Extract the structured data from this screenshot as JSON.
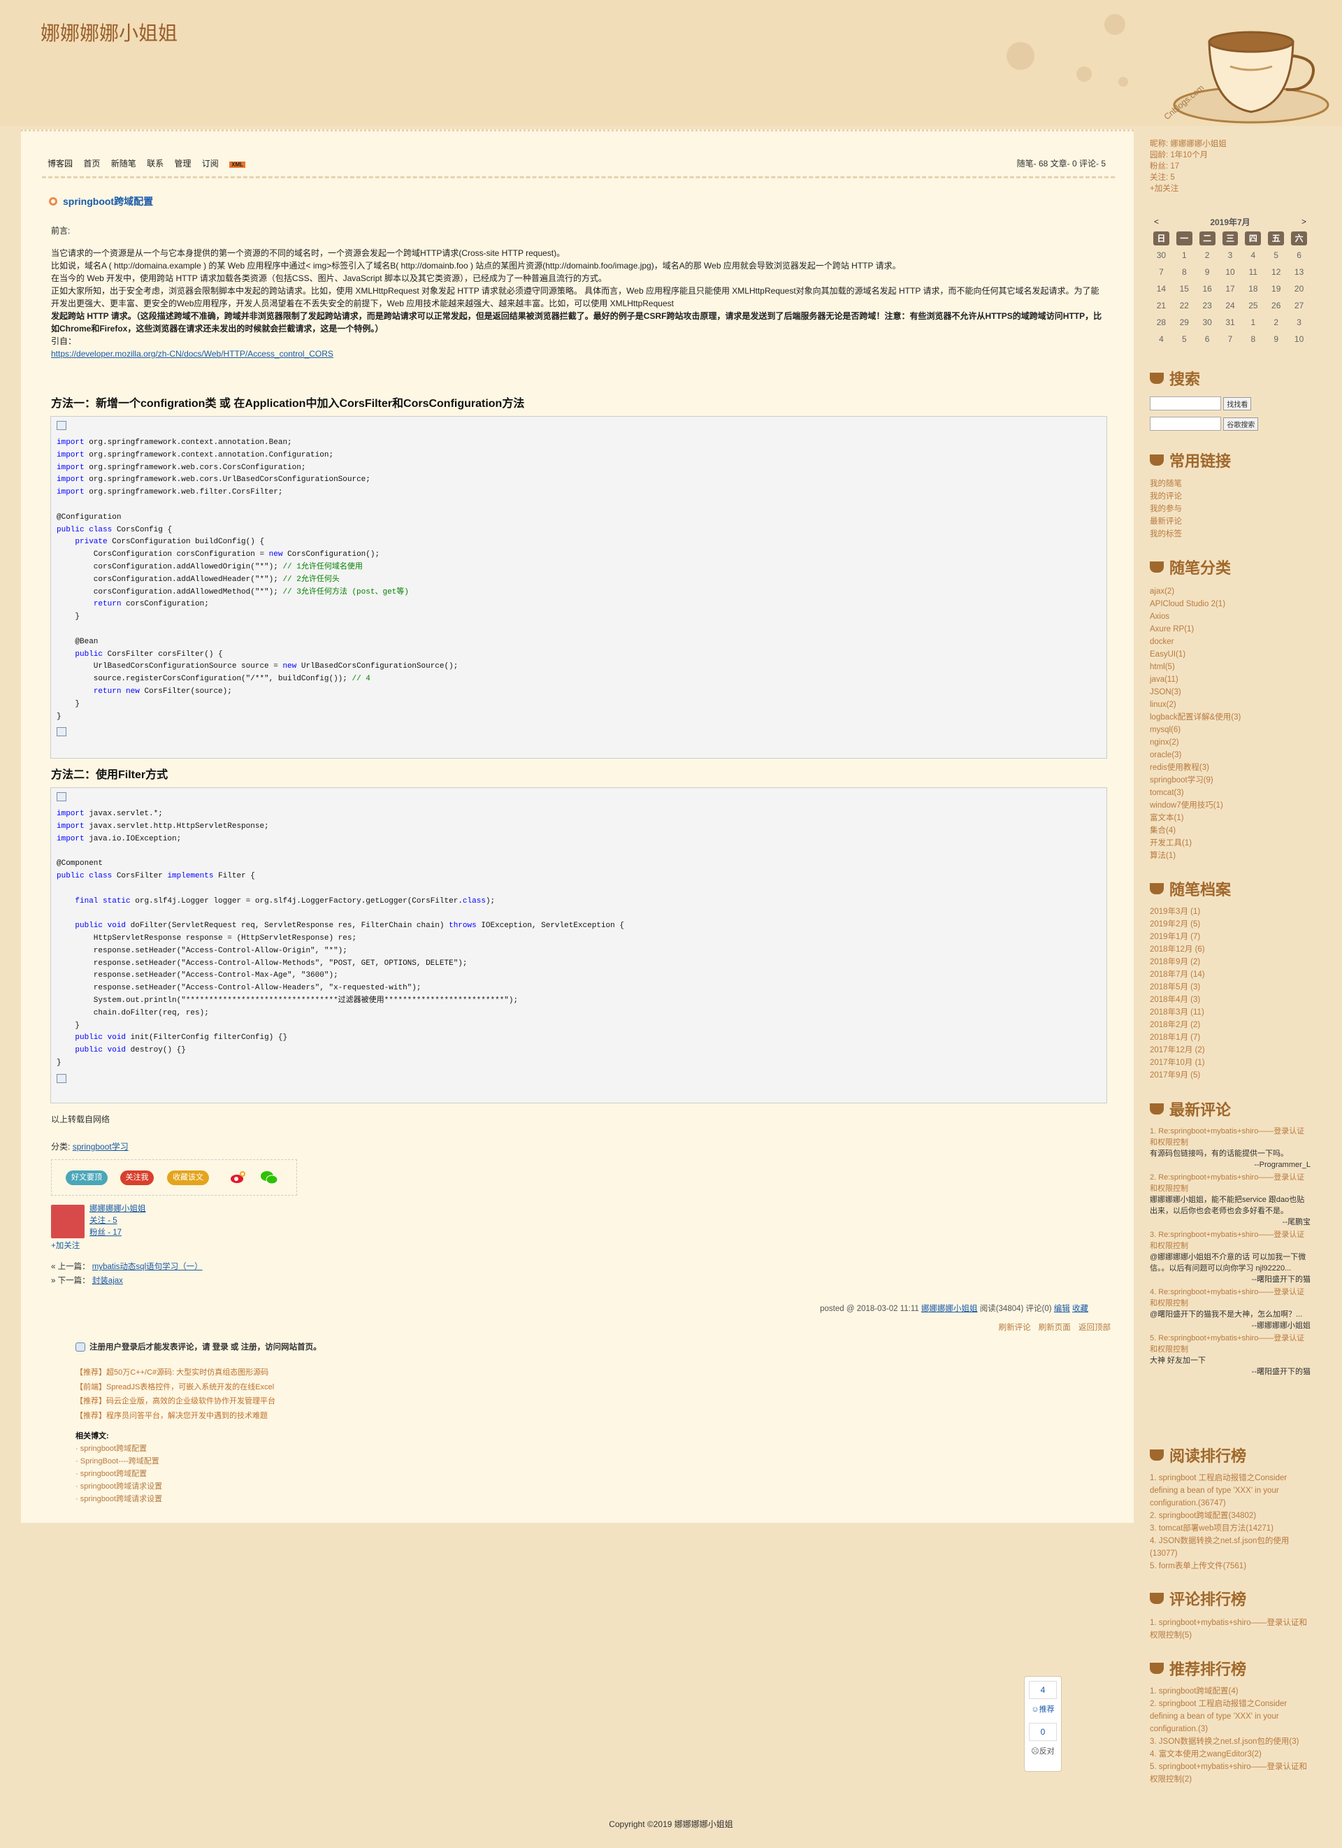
{
  "blog": {
    "title": "娜娜娜娜小姐姐",
    "cup_text": "Cnblogs.com"
  },
  "nav": [
    "博客园",
    "首页",
    "新随笔",
    "联系",
    "管理",
    "订阅"
  ],
  "nav_xml": "XML",
  "stats": "随笔- 68  文章- 0  评论- 5",
  "post": {
    "title": "springboot跨域配置",
    "intro_label": "前言:",
    "paragraphs": [
      "当它请求的一个资源是从一个与它本身提供的第一个资源的不同的域名时，一个资源会发起一个跨域HTTP请求(Cross-site HTTP request)。",
      "比如说，域名A ( http://domaina.example ) 的某 Web 应用程序中通过< img>标签引入了域名B( http://domainb.foo ) 站点的某图片资源(http://domainb.foo/image.jpg)，域名A的那 Web 应用就会导致浏览器发起一个跨站 HTTP 请求。",
      "在当今的 Web 开发中，使用跨站 HTTP 请求加载各类资源（包括CSS、图片、JavaScript 脚本以及其它类资源），已经成为了一种普遍且流行的方式。",
      "正如大家所知，出于安全考虑，浏览器会限制脚本中发起的跨站请求。比如，使用 XMLHttpRequest 对象发起 HTTP 请求就必须遵守同源策略。 具体而言，Web 应用程序能且只能使用 XMLHttpRequest对象向其加载的源域名发起 HTTP 请求，而不能向任何其它域名发起请求。为了能开发出更强大、更丰富、更安全的Web应用程序，开发人员渴望着在不丢失安全的前提下，Web 应用技术能越来越强大、越来越丰富。比如，可以使用 XMLHttpRequest",
      "发起跨站 HTTP 请求。（这段描述跨域不准确，跨域并非浏览器限制了发起跨站请求，而是跨站请求可以正常发起，但是返回结果被浏览器拦截了。最好的例子是CSRF跨站攻击原理，请求是发送到了后端服务器无论是否跨域！注意：有些浏览器不允许从HTTPS的域跨域访问HTTP，比如Chrome和Firefox，这些浏览器在请求还未发出的时候就会拦截请求，这是一个特例。）",
      "引自："
    ],
    "ref_link": "https://developer.mozilla.org/zh-CN/docs/Web/HTTP/Access_control_CORS",
    "method1_title": "方法一：新增一个configration类 或 在Application中加入CorsFilter和CorsConfiguration方法",
    "method2_title": "方法二：使用Filter方式",
    "end_note": "以上转载自网络",
    "category_label": "分类:",
    "category": "springboot学习",
    "share_buttons": [
      "好文要顶",
      "关注我",
      "收藏该文"
    ],
    "author": {
      "name": "娜娜娜娜小姐姐",
      "follow": "关注 - 5",
      "fans": "粉丝 - 17",
      "add_follow": "+加关注"
    },
    "prev_label": "« 上一篇：",
    "prev": "mybatis动态sql语句学习（一）",
    "next_label": "» 下一篇：",
    "next": "封装ajax",
    "posted": "posted @ 2018-03-02 11:11",
    "posted_author": "娜娜娜娜小姐姐",
    "posted_stats": "阅读(34804) 评论(0)",
    "edit": "编辑",
    "collect": "收藏",
    "bottom_links": [
      "刷新评论",
      "刷新页面",
      "返回顶部"
    ],
    "login_notice": "注册用户登录后才能发表评论，请 登录 或 注册，访问网站首页。",
    "ads": [
      "【推荐】超50万C++/C#源码: 大型实时仿真组态图形源码",
      "【前端】SpreadJS表格控件，可嵌入系统开发的在线Excel",
      "【推荐】码云企业版，高效的企业级软件协作开发管理平台",
      "【推荐】程序员问答平台，解决您开发中遇到的技术难题"
    ],
    "related_title": "相关博文:",
    "related": [
      "springboot跨域配置",
      "SpringBoot----跨域配置",
      "springboot跨域配置",
      "springboot跨域请求设置",
      "springboot跨域请求设置"
    ]
  },
  "code1": [
    "import org.springframework.context.annotation.Bean;",
    "import org.springframework.context.annotation.Configuration;",
    "import org.springframework.web.cors.CorsConfiguration;",
    "import org.springframework.web.cors.UrlBasedCorsConfigurationSource;",
    "import org.springframework.web.filter.CorsFilter;",
    "",
    "@Configuration",
    "public class CorsConfig {",
    "    private CorsConfiguration buildConfig() {",
    "        CorsConfiguration corsConfiguration = new CorsConfiguration();",
    "        corsConfiguration.addAllowedOrigin(\"*\"); // 1允许任何域名使用",
    "        corsConfiguration.addAllowedHeader(\"*\"); // 2允许任何头",
    "        corsConfiguration.addAllowedMethod(\"*\"); // 3允许任何方法 (post、get等)",
    "        return corsConfiguration;",
    "    }",
    "",
    "    @Bean",
    "    public CorsFilter corsFilter() {",
    "        UrlBasedCorsConfigurationSource source = new UrlBasedCorsConfigurationSource();",
    "        source.registerCorsConfiguration(\"/**\", buildConfig()); // 4",
    "        return new CorsFilter(source);",
    "    }",
    "}"
  ],
  "code2": [
    "import javax.servlet.*;",
    "import javax.servlet.http.HttpServletResponse;",
    "import java.io.IOException;",
    "",
    "@Component",
    "public class CorsFilter implements Filter {",
    "",
    "    final static org.slf4j.Logger logger = org.slf4j.LoggerFactory.getLogger(CorsFilter.class);",
    "",
    "    public void doFilter(ServletRequest req, ServletResponse res, FilterChain chain) throws IOException, ServletException {",
    "        HttpServletResponse response = (HttpServletResponse) res;",
    "        response.setHeader(\"Access-Control-Allow-Origin\", \"*\");",
    "        response.setHeader(\"Access-Control-Allow-Methods\", \"POST, GET, OPTIONS, DELETE\");",
    "        response.setHeader(\"Access-Control-Max-Age\", \"3600\");",
    "        response.setHeader(\"Access-Control-Allow-Headers\", \"x-requested-with\");",
    "        System.out.println(\"*********************************过滤器被使用**************************\");",
    "        chain.doFilter(req, res);",
    "    }",
    "    public void init(FilterConfig filterConfig) {}",
    "    public void destroy() {}",
    "}"
  ],
  "sidebar": {
    "profile": [
      "昵称: 娜娜娜娜小姐姐",
      "园龄: 1年10个月",
      "粉丝: 17",
      "关注: 5",
      "+加关注"
    ],
    "calendar": {
      "title": "2019年7月",
      "prev": "<",
      "next": ">",
      "weekdays": [
        "日",
        "一",
        "二",
        "三",
        "四",
        "五",
        "六"
      ],
      "weeks": [
        [
          "30",
          "1",
          "2",
          "3",
          "4",
          "5",
          "6"
        ],
        [
          "7",
          "8",
          "9",
          "10",
          "11",
          "12",
          "13"
        ],
        [
          "14",
          "15",
          "16",
          "17",
          "18",
          "19",
          "20"
        ],
        [
          "21",
          "22",
          "23",
          "24",
          "25",
          "26",
          "27"
        ],
        [
          "28",
          "29",
          "30",
          "31",
          "1",
          "2",
          "3"
        ],
        [
          "4",
          "5",
          "6",
          "7",
          "8",
          "9",
          "10"
        ]
      ]
    },
    "search_title": "搜索",
    "search_btn1": "找找看",
    "search_btn2": "谷歌搜索",
    "links_title": "常用链接",
    "links": [
      "我的随笔",
      "我的评论",
      "我的参与",
      "最新评论",
      "我的标签"
    ],
    "categories_title": "随笔分类",
    "categories": [
      "ajax(2)",
      "APICloud Studio 2(1)",
      "Axios",
      "Axure RP(1)",
      "docker",
      "EasyUI(1)",
      "html(5)",
      "java(11)",
      "JSON(3)",
      "linux(2)",
      "logback配置详解&使用(3)",
      "mysql(6)",
      "nginx(2)",
      "oracle(3)",
      "redis使用教程(3)",
      "springboot学习(9)",
      "tomcat(3)",
      "window7使用技巧(1)",
      "富文本(1)",
      "集合(4)",
      "开发工具(1)",
      "算法(1)"
    ],
    "archive_title": "随笔档案",
    "archive": [
      "2019年3月 (1)",
      "2019年2月 (5)",
      "2019年1月 (7)",
      "2018年12月 (6)",
      "2018年9月 (2)",
      "2018年7月 (14)",
      "2018年5月 (3)",
      "2018年4月 (3)",
      "2018年3月 (11)",
      "2018年2月 (2)",
      "2018年1月 (7)",
      "2017年12月 (2)",
      "2017年10月 (1)",
      "2017年9月 (5)"
    ],
    "comments_title": "最新评论",
    "comments": [
      {
        "title": "1. Re:springboot+mybatis+shiro——登录认证和权限控制",
        "body": "有源码包链接吗，有的话能提供一下吗。",
        "author": "--Programmer_L"
      },
      {
        "title": "2. Re:springboot+mybatis+shiro——登录认证和权限控制",
        "body": "娜娜娜娜小姐姐，能不能把service 跟dao也贴出来，以后你也会老师也会多好看不是。",
        "author": "--尾鹏宝"
      },
      {
        "title": "3. Re:springboot+mybatis+shiro——登录认证和权限控制",
        "body": "@娜娜娜娜小姐姐不介意的话 可以加我一下微信。。以后有问题可以向你学习 njl92220...",
        "author": "--曙阳盛开下的猫"
      },
      {
        "title": "4. Re:springboot+mybatis+shiro——登录认证和权限控制",
        "body": "@曙阳盛开下的猫我不是大神，怎么加啊？...",
        "author": "--娜娜娜娜小姐姐"
      },
      {
        "title": "5. Re:springboot+mybatis+shiro——登录认证和权限控制",
        "body": "大神 好友加一下",
        "author": "--曙阳盛开下的猫"
      }
    ],
    "readrank_title": "阅读排行榜",
    "readrank": [
      "1. springboot 工程启动报错之Consider defining a bean of type 'XXX' in your configuration.(36747)",
      "2. springboot跨域配置(34802)",
      "3. tomcat部署web项目方法(14271)",
      "4. JSON数据转换之net.sf.json包的使用(13077)",
      "5. form表单上传文件(7561)"
    ],
    "commentrank_title": "评论排行榜",
    "commentrank": [
      "1. springboot+mybatis+shiro——登录认证和权限控制(5)"
    ],
    "recommend_title": "推荐排行榜",
    "recommend": [
      "1. springboot跨域配置(4)",
      "2. springboot 工程启动报错之Consider defining a bean of type 'XXX' in your configuration.(3)",
      "3. JSON数据转换之net.sf.json包的使用(3)",
      "4. 富文本使用之wangEditor3(2)",
      "5. springboot+mybatis+shiro——登录认证和权限控制(2)"
    ]
  },
  "vote": {
    "digg_count": "4",
    "digg_label": "推荐",
    "bury_count": "0",
    "bury_label": "反对"
  },
  "footer": "Copyright ©2019 娜娜娜娜小姐姐"
}
